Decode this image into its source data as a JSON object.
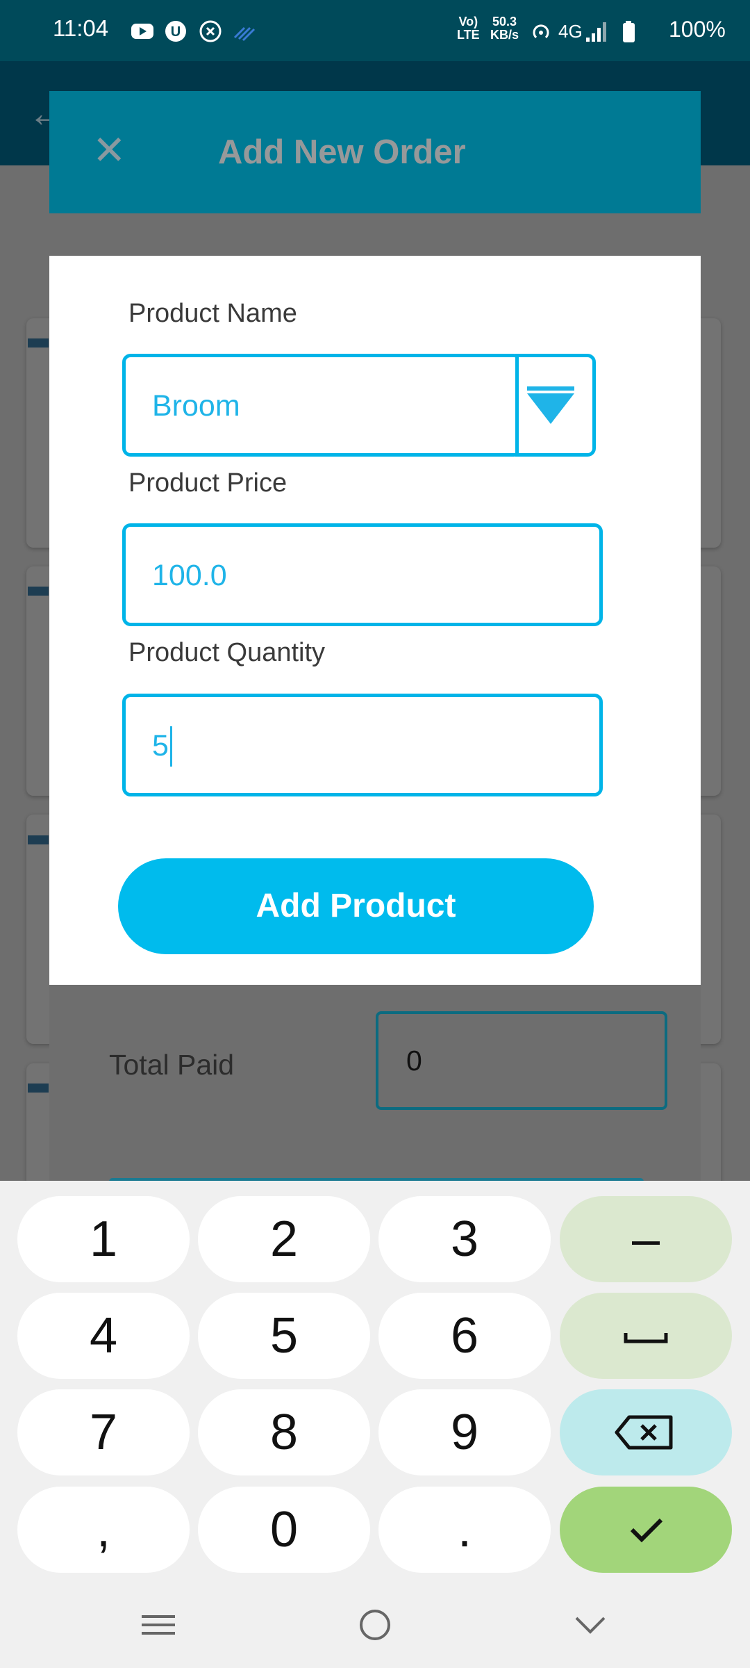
{
  "status_bar": {
    "time": "11:04",
    "net_line1": "Vo)",
    "net_line2": "LTE",
    "speed_line1": "50.3",
    "speed_line2": "KB/s",
    "network": "4G",
    "battery": "100%"
  },
  "order_dialog": {
    "title": "Add New Order",
    "total_paid_label": "Total Paid",
    "total_paid_value": "0"
  },
  "product_form": {
    "name_label": "Product Name",
    "name_value": "Broom",
    "price_label": "Product Price",
    "price_value": "100.0",
    "quantity_label": "Product Quantity",
    "quantity_value": "5",
    "submit_label": "Add Product"
  },
  "keyboard": {
    "keys": [
      "1",
      "2",
      "3",
      "–",
      "4",
      "5",
      "6",
      "␣",
      "7",
      "8",
      "9",
      "⌫",
      ",",
      "0",
      ".",
      "✓"
    ]
  },
  "colors": {
    "accent": "#00bbed",
    "status_bar": "#004a5a",
    "header": "#007a94",
    "confirm_key": "#a2d57a"
  }
}
